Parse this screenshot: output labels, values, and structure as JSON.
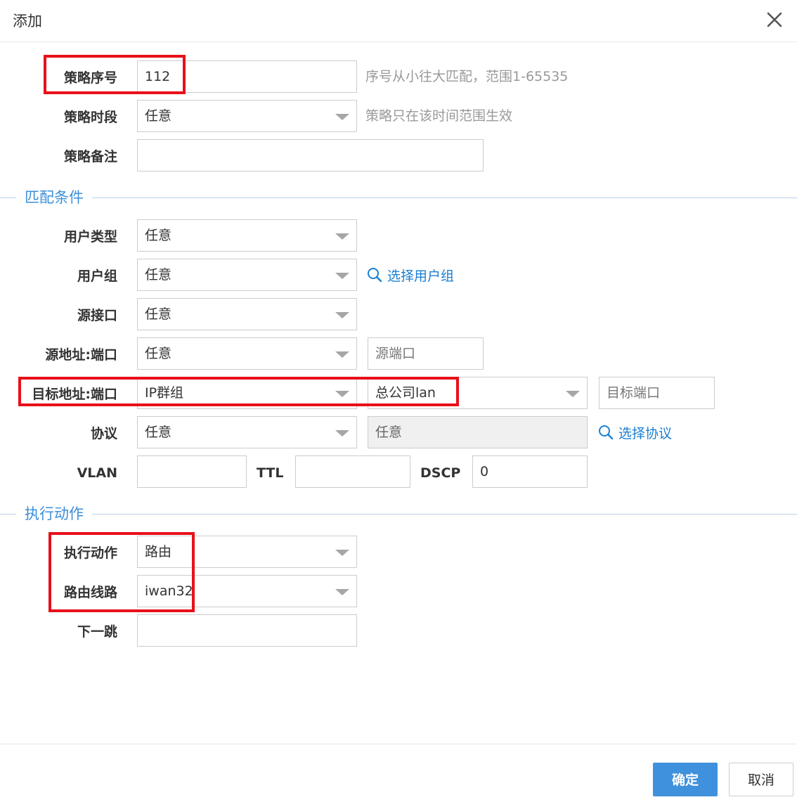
{
  "dialog": {
    "title": "添加",
    "close_icon": "close-icon"
  },
  "fields": {
    "seq": {
      "label": "策略序号",
      "value": "112",
      "hint": "序号从小往大匹配，范围1-65535"
    },
    "period": {
      "label": "策略时段",
      "value": "任意",
      "hint": "策略只在该时间范围生效"
    },
    "remark": {
      "label": "策略备注",
      "value": ""
    }
  },
  "match": {
    "section_title": "匹配条件",
    "user_type": {
      "label": "用户类型",
      "value": "任意"
    },
    "user_group": {
      "label": "用户组",
      "value": "任意",
      "link": "选择用户组"
    },
    "src_iface": {
      "label": "源接口",
      "value": "任意"
    },
    "src_addr": {
      "label": "源地址:端口",
      "value": "任意",
      "port_placeholder": "源端口"
    },
    "dst_addr": {
      "label": "目标地址:端口",
      "value": "IP群组",
      "group": "总公司lan",
      "port_placeholder": "目标端口"
    },
    "protocol": {
      "label": "协议",
      "value": "任意",
      "detail": "任意",
      "link": "选择协议"
    },
    "vlan": {
      "label": "VLAN",
      "value": ""
    },
    "ttl": {
      "label": "TTL",
      "value": ""
    },
    "dscp": {
      "label": "DSCP",
      "value": "0"
    }
  },
  "action": {
    "section_title": "执行动作",
    "exec": {
      "label": "执行动作",
      "value": "路由"
    },
    "route": {
      "label": "路由线路",
      "value": "iwan32"
    },
    "next_hop": {
      "label": "下一跳",
      "value": ""
    }
  },
  "buttons": {
    "ok": "确定",
    "cancel": "取消"
  },
  "colors": {
    "primary": "#3f91dd",
    "link": "#1a7fd4",
    "section": "#3c8fd8",
    "highlight": "#e8101a"
  }
}
